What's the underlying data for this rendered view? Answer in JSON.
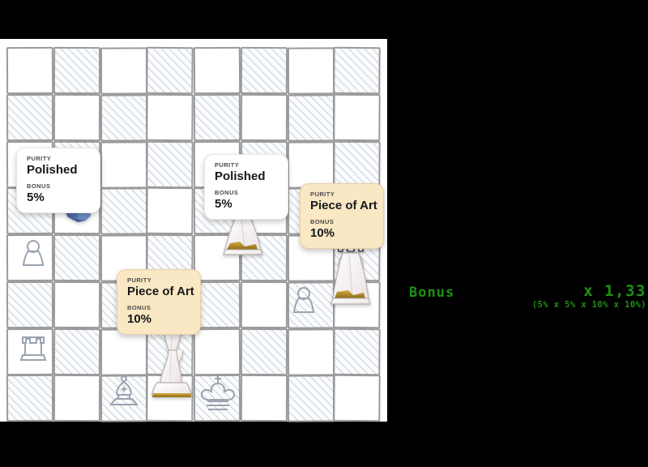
{
  "board": {
    "size": 8,
    "light_color": "#ffffff",
    "dark_color": "#eef1f5",
    "border_color": "#9a9a9a"
  },
  "cards": [
    {
      "id": "card-polished-knight",
      "style": "white",
      "purity_label": "PURITY",
      "purity_value": "Polished",
      "bonus_label": "BONUS",
      "bonus_value": "5%"
    },
    {
      "id": "card-polished-pawn",
      "style": "white",
      "purity_label": "PURITY",
      "purity_value": "Polished",
      "bonus_label": "BONUS",
      "bonus_value": "5%"
    },
    {
      "id": "card-art-rook",
      "style": "amber",
      "purity_label": "PURITY",
      "purity_value": "Piece of Art",
      "bonus_label": "BONUS",
      "bonus_value": "10%"
    },
    {
      "id": "card-art-king",
      "style": "amber",
      "purity_label": "PURITY",
      "purity_value": "Piece of Art",
      "bonus_label": "BONUS",
      "bonus_value": "10%"
    }
  ],
  "pieces": [
    {
      "id": "knight-blue-crystal",
      "name": "knight",
      "material": "crystal-blue"
    },
    {
      "id": "pawn-white-marble",
      "name": "pawn",
      "material": "white-marble"
    },
    {
      "id": "rook-white-marble",
      "name": "rook",
      "material": "white-marble"
    },
    {
      "id": "king-white-marble",
      "name": "king",
      "material": "white-marble"
    }
  ],
  "ghost_pieces": [
    {
      "id": "ghost-pawn-a4",
      "name": "pawn"
    },
    {
      "id": "ghost-rook-a2",
      "name": "rook"
    },
    {
      "id": "ghost-pawn-f3",
      "name": "pawn"
    },
    {
      "id": "ghost-bishop-c1",
      "name": "bishop"
    },
    {
      "id": "ghost-king-e1",
      "name": "king"
    }
  ],
  "bonus": {
    "label": "Bonus",
    "multiplier": "x 1,33",
    "detail": "(5% x 5% x 10% x 10%)",
    "color": "#1f9113"
  }
}
